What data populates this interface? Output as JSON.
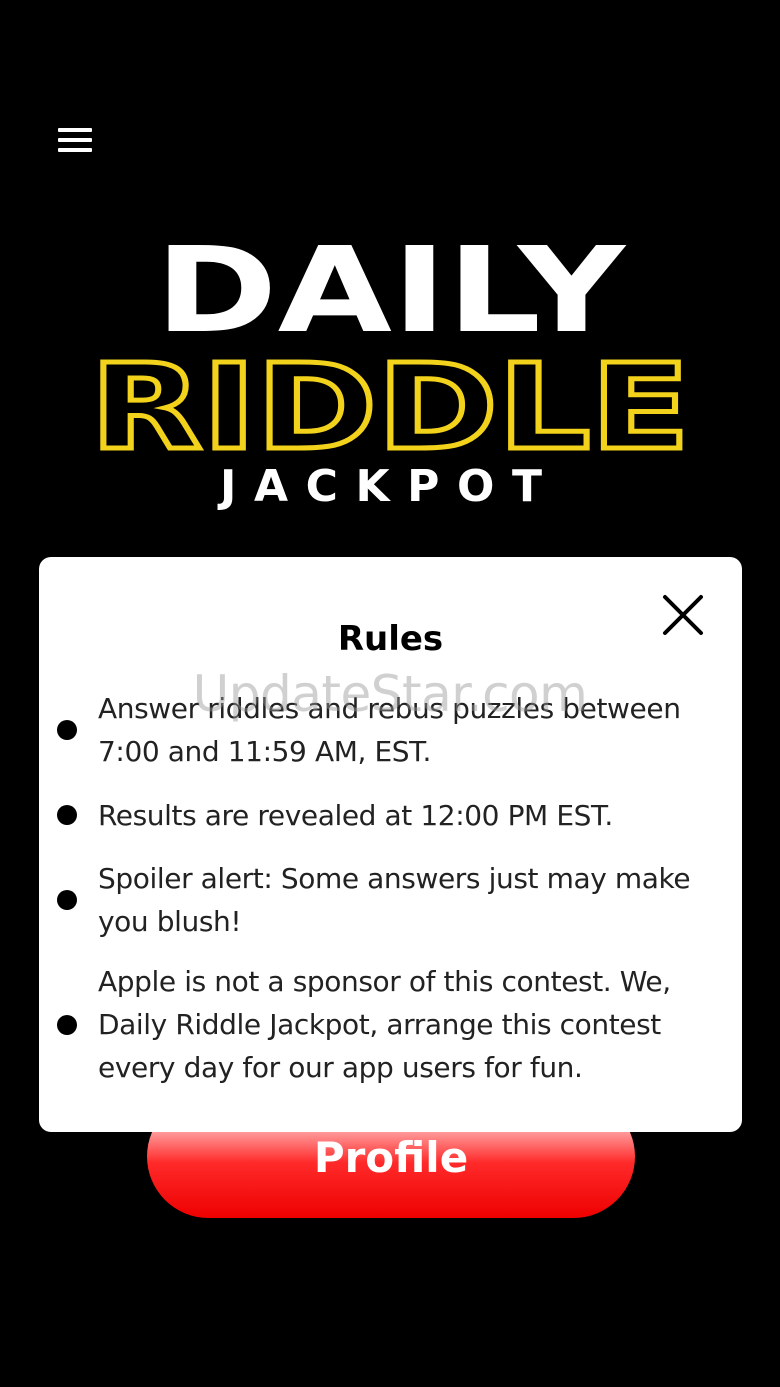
{
  "logo": {
    "line1": "DAILY",
    "line2": "RIDDLE",
    "line3": "JACKPOT"
  },
  "colors": {
    "background": "#000000",
    "logo_white": "#ffffff",
    "logo_yellow": "#f2d21b",
    "button_red": "#ee0000",
    "dialog_bg": "#ffffff"
  },
  "icons": {
    "menu": "hamburger-menu-icon",
    "close": "close-x-icon"
  },
  "profile_button": {
    "label": "Profile"
  },
  "rules_dialog": {
    "title": "Rules",
    "rules": [
      "Answer riddles and rebus puzzles between 7:00 and 11:59 AM, EST.",
      "Results are revealed at 12:00 PM EST.",
      "Spoiler alert: Some answers just may make you blush!",
      "Apple is not a sponsor of this contest. We, Daily Riddle Jackpot, arrange this contest every day for our app users for fun."
    ]
  },
  "watermark": "UpdateStar.com"
}
